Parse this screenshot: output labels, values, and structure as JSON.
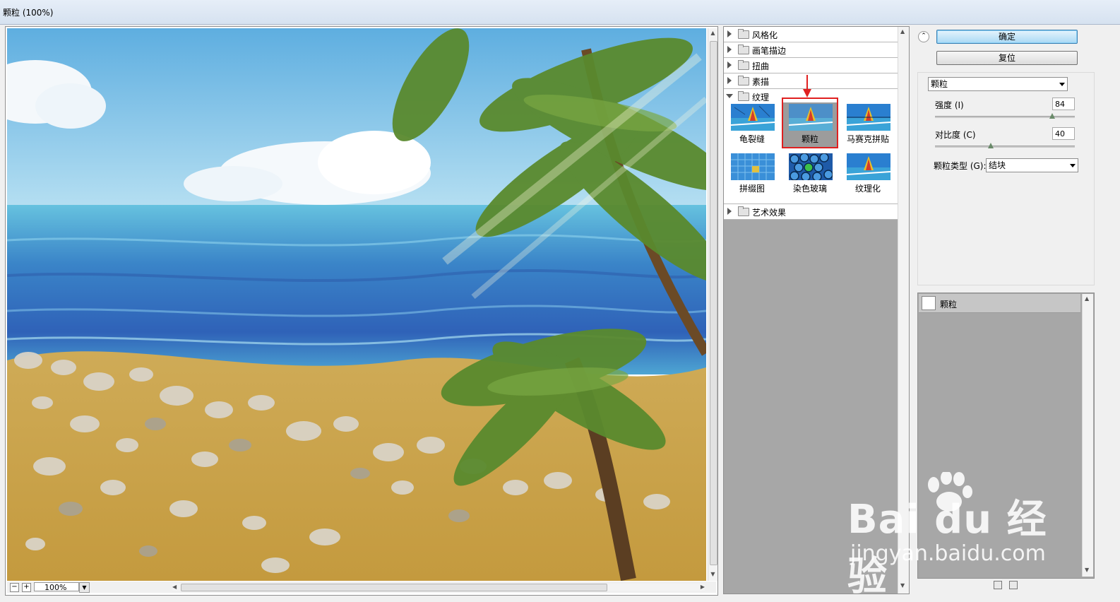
{
  "window": {
    "title": "颗粒 (100%)"
  },
  "preview": {
    "zoom_value": "100%",
    "zoom_out": "−",
    "zoom_in": "+"
  },
  "filter_gallery": {
    "categories_top": [
      {
        "name": "风格化"
      },
      {
        "name": "画笔描边"
      },
      {
        "name": "扭曲"
      },
      {
        "name": "素描"
      }
    ],
    "open_category": "纹理",
    "texture_filters": [
      {
        "name": "龟裂缝"
      },
      {
        "name": "颗粒"
      },
      {
        "name": "马赛克拼贴"
      },
      {
        "name": "拼缀图"
      },
      {
        "name": "染色玻璃"
      },
      {
        "name": "纹理化"
      }
    ],
    "categories_bottom": [
      {
        "name": "艺术效果"
      }
    ]
  },
  "buttons": {
    "ok": "确定",
    "reset": "复位"
  },
  "settings": {
    "filter_select": "颗粒",
    "intensity_label": "强度 (I)",
    "intensity_value": "84",
    "intensity_level": 84,
    "contrast_label": "对比度 (C)",
    "contrast_value": "40",
    "contrast_level": 40,
    "grain_type_label": "颗粒类型 (G):",
    "grain_type_value": "结块"
  },
  "effect_layers": [
    {
      "name": "颗粒"
    }
  ],
  "watermark": {
    "main": "Bai du 经验",
    "sub": "jingyan.baidu.com"
  },
  "colors": {
    "selection_border": "#e02020",
    "ok_button": "#a9d9f5"
  }
}
